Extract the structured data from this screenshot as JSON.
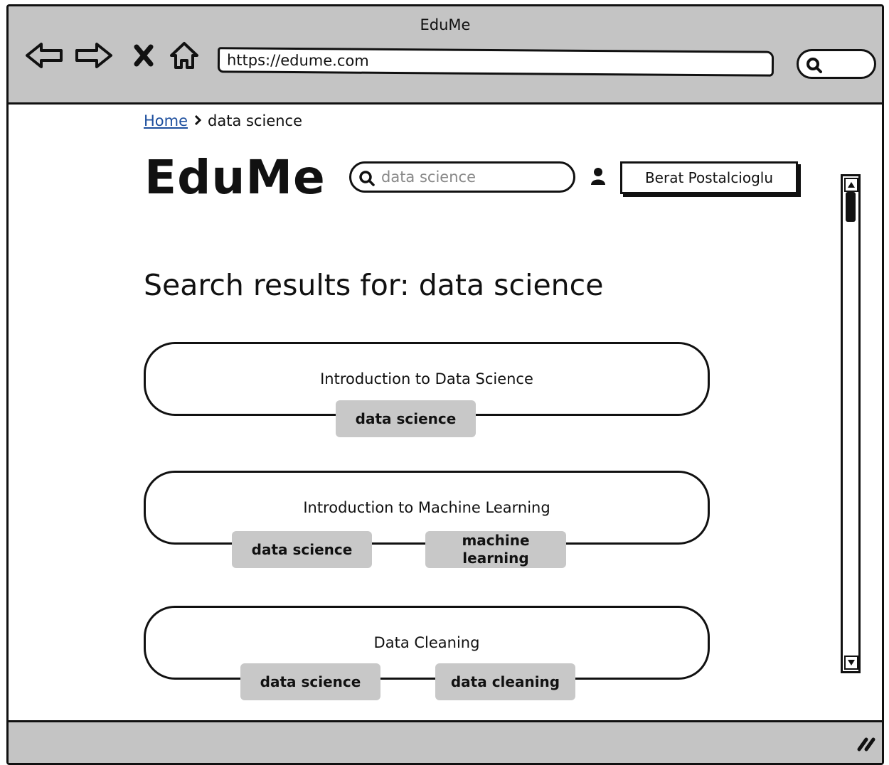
{
  "browser": {
    "window_title": "EduMe",
    "url": "https://edume.com",
    "nav_icons": [
      "back-arrow-icon",
      "forward-arrow-icon",
      "stop-icon",
      "home-icon"
    ]
  },
  "breadcrumb": {
    "home_label": "Home",
    "current_label": "data science"
  },
  "header": {
    "logo": "EduMe",
    "search_value": "data science",
    "user_name": "Berat Postalcioglu"
  },
  "main": {
    "title": "Search results for: data science",
    "results": [
      {
        "title": "Introduction to Data Science",
        "tags": [
          "data science"
        ]
      },
      {
        "title": "Introduction to Machine Learning",
        "tags": [
          "data science",
          "machine learning"
        ]
      },
      {
        "title": "Data Cleaning",
        "tags": [
          "data science",
          "data cleaning"
        ]
      }
    ]
  },
  "colors": {
    "chrome_gray": "#c4c4c4",
    "tag_gray": "#c8c8c8",
    "link_blue": "#1d4f9e"
  }
}
